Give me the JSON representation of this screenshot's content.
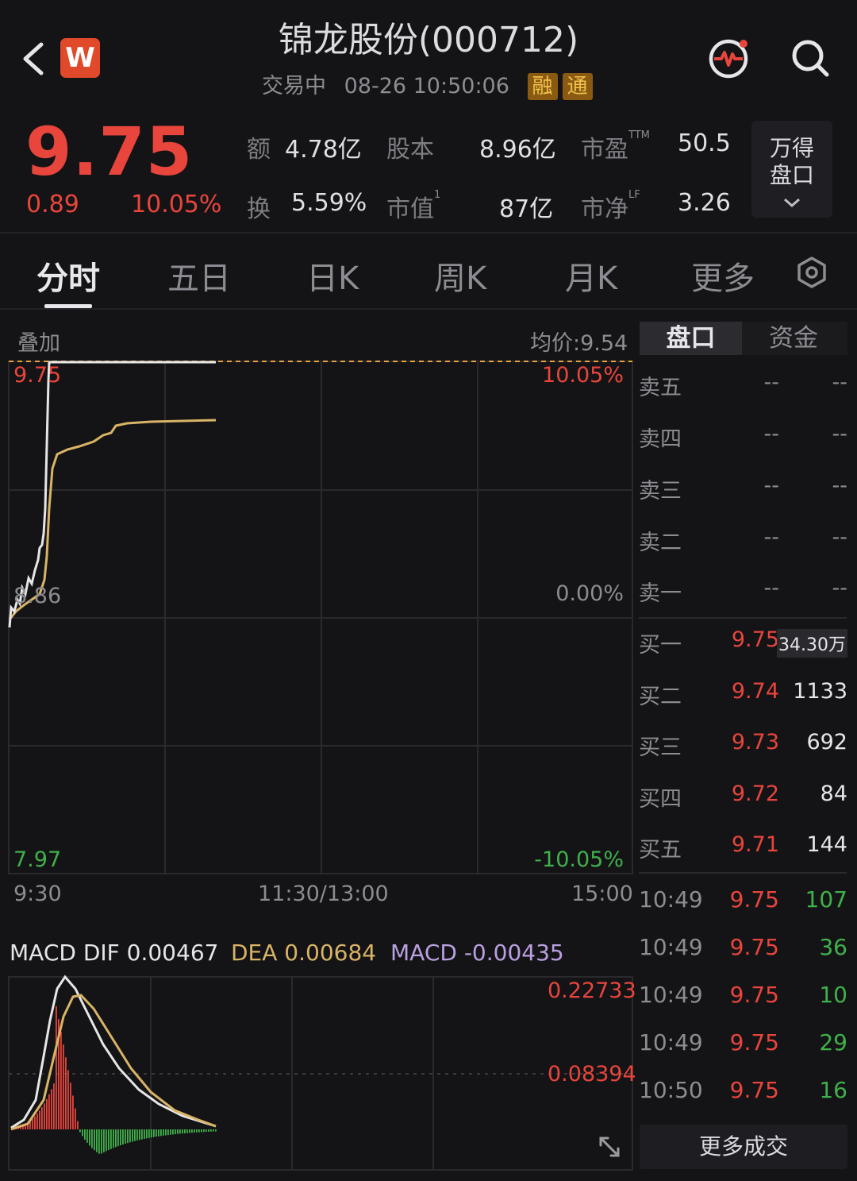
{
  "header": {
    "title": "锦龙股份(000712)",
    "status": "交易中",
    "datetime": "08-26 10:50:06",
    "tags": [
      "融",
      "通"
    ],
    "logo_letter": "W"
  },
  "quote": {
    "price": "9.75",
    "change": "0.89",
    "change_pct": "10.05%",
    "metrics": [
      {
        "label": "额",
        "sup": "",
        "value": "4.78亿"
      },
      {
        "label": "换",
        "sup": "",
        "value": "5.59%"
      },
      {
        "label": "股本",
        "sup": "",
        "value": "8.96亿"
      },
      {
        "label": "市值",
        "sup": "1",
        "value": "87亿"
      },
      {
        "label": "市盈",
        "sup": "TTM",
        "value": "50.5"
      },
      {
        "label": "市净",
        "sup": "LF",
        "value": "3.26"
      }
    ],
    "wind_button": [
      "万得",
      "盘口"
    ]
  },
  "tabs": [
    "分时",
    "五日",
    "日K",
    "周K",
    "月K",
    "更多"
  ],
  "active_tab": "分时",
  "chart": {
    "overlay_label": "叠加",
    "avg_price_label": "均价:9.54",
    "price_high": "9.75",
    "price_mid": "8.86",
    "price_low": "7.97",
    "pct_high": "10.05%",
    "pct_mid": "0.00%",
    "pct_low": "-10.05%",
    "time_start": "9:30",
    "time_mid": "11:30/13:00",
    "time_end": "15:00",
    "macd_dif": "MACD DIF 0.00467",
    "macd_dea": "DEA 0.00684",
    "macd_val": "MACD -0.00435",
    "macd_high": "0.22733",
    "macd_mid": "0.08394",
    "colors": {
      "price_line": "#e6e6e6",
      "avg_line": "#d9b466",
      "up": "#e8453c",
      "down": "#3fb14a",
      "macd": "#b9a0e0"
    }
  },
  "order_book": {
    "tab_active": "盘口",
    "tab_other": "资金",
    "asks": [
      {
        "label": "卖五",
        "price": "--",
        "vol": "--"
      },
      {
        "label": "卖四",
        "price": "--",
        "vol": "--"
      },
      {
        "label": "卖三",
        "price": "--",
        "vol": "--"
      },
      {
        "label": "卖二",
        "price": "--",
        "vol": "--"
      },
      {
        "label": "卖一",
        "price": "--",
        "vol": "--"
      }
    ],
    "bids": [
      {
        "label": "买一",
        "price": "9.75",
        "vol": "34.30万"
      },
      {
        "label": "买二",
        "price": "9.74",
        "vol": "1133"
      },
      {
        "label": "买三",
        "price": "9.73",
        "vol": "692"
      },
      {
        "label": "买四",
        "price": "9.72",
        "vol": "84"
      },
      {
        "label": "买五",
        "price": "9.71",
        "vol": "144"
      }
    ],
    "trades": [
      {
        "time": "10:49",
        "price": "9.75",
        "vol": "107"
      },
      {
        "time": "10:49",
        "price": "9.75",
        "vol": "36"
      },
      {
        "time": "10:49",
        "price": "9.75",
        "vol": "10"
      },
      {
        "time": "10:49",
        "price": "9.75",
        "vol": "29"
      },
      {
        "time": "10:50",
        "price": "9.75",
        "vol": "16"
      }
    ],
    "more_trades_label": "更多成交"
  }
}
